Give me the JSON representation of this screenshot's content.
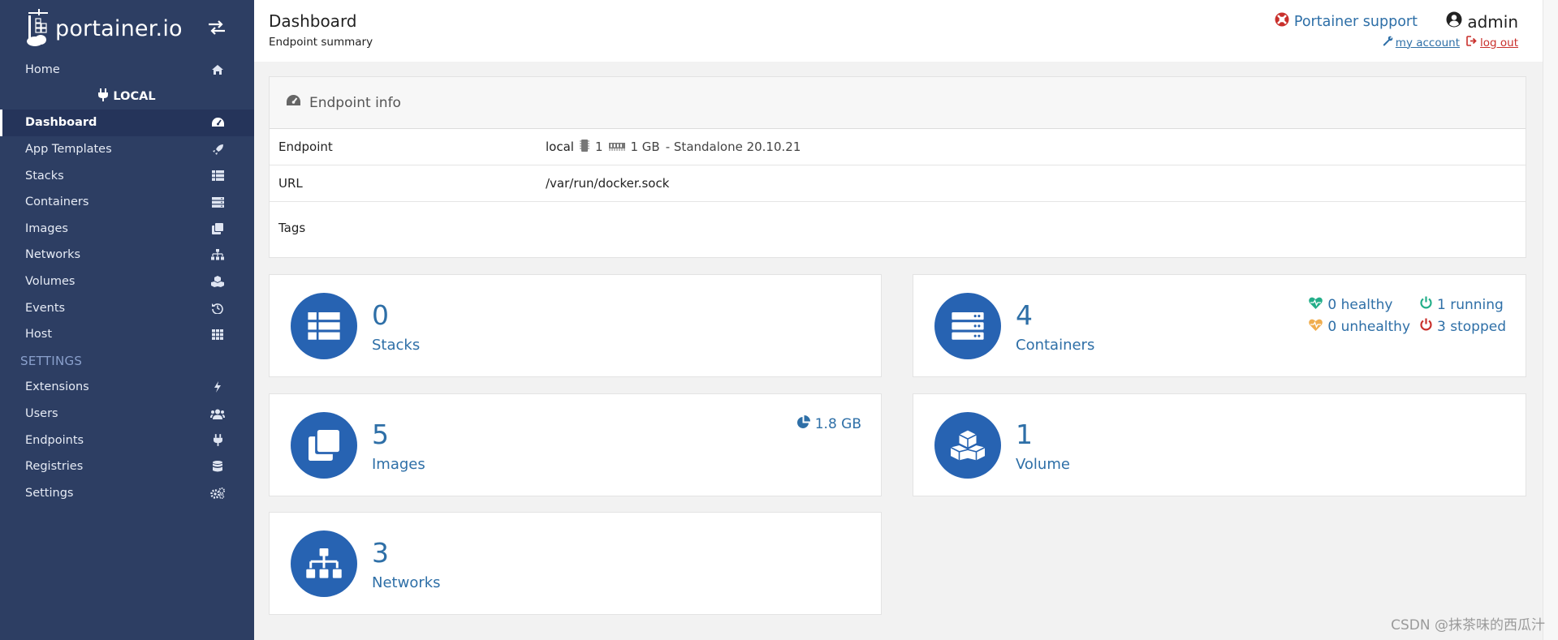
{
  "brand": {
    "name": "portainer.io"
  },
  "sidebar": {
    "items_top": [
      {
        "label": "Home",
        "icon": "home-icon"
      }
    ],
    "endpoint_label": "LOCAL",
    "items_endpoint": [
      {
        "label": "Dashboard",
        "icon": "tachometer-icon",
        "active": true
      },
      {
        "label": "App Templates",
        "icon": "rocket-icon"
      },
      {
        "label": "Stacks",
        "icon": "th-list-icon"
      },
      {
        "label": "Containers",
        "icon": "server-icon"
      },
      {
        "label": "Images",
        "icon": "clone-icon"
      },
      {
        "label": "Networks",
        "icon": "sitemap-icon"
      },
      {
        "label": "Volumes",
        "icon": "cubes-icon"
      },
      {
        "label": "Events",
        "icon": "history-icon"
      },
      {
        "label": "Host",
        "icon": "th-icon"
      }
    ],
    "settings_section": "SETTINGS",
    "items_settings": [
      {
        "label": "Extensions",
        "icon": "bolt-icon"
      },
      {
        "label": "Users",
        "icon": "users-icon"
      },
      {
        "label": "Endpoints",
        "icon": "plug-icon"
      },
      {
        "label": "Registries",
        "icon": "database-icon"
      },
      {
        "label": "Settings",
        "icon": "cogs-icon"
      }
    ]
  },
  "header": {
    "title": "Dashboard",
    "subtitle": "Endpoint summary",
    "support": "Portainer support",
    "user": "admin",
    "my_account": "my account",
    "log_out": "log out"
  },
  "endpoint_info": {
    "title": "Endpoint info",
    "rows": [
      {
        "key": "Endpoint",
        "name": "local",
        "cpu": "1",
        "memory": "1 GB",
        "details": "- Standalone 20.10.21"
      },
      {
        "key": "URL",
        "value": "/var/run/docker.sock"
      },
      {
        "key": "Tags",
        "value": ""
      }
    ]
  },
  "widgets": {
    "stacks": {
      "count": "0",
      "label": "Stacks"
    },
    "containers": {
      "count": "4",
      "label": "Containers",
      "healthy": "0 healthy",
      "running": "1 running",
      "unhealthy": "0 unhealthy",
      "stopped": "3 stopped"
    },
    "images": {
      "count": "5",
      "label": "Images",
      "size": "1.8 GB"
    },
    "volumes": {
      "count": "1",
      "label": "Volume"
    },
    "networks": {
      "count": "3",
      "label": "Networks"
    }
  },
  "colors": {
    "sidebar": "#2d3e63",
    "accent": "#2e6fa7",
    "circle": "#2763b2",
    "healthy": "#23ae89",
    "unhealthy": "#f0ad4e",
    "stopped": "#c9302c"
  },
  "watermark": "CSDN @抹茶味的西瓜汁"
}
